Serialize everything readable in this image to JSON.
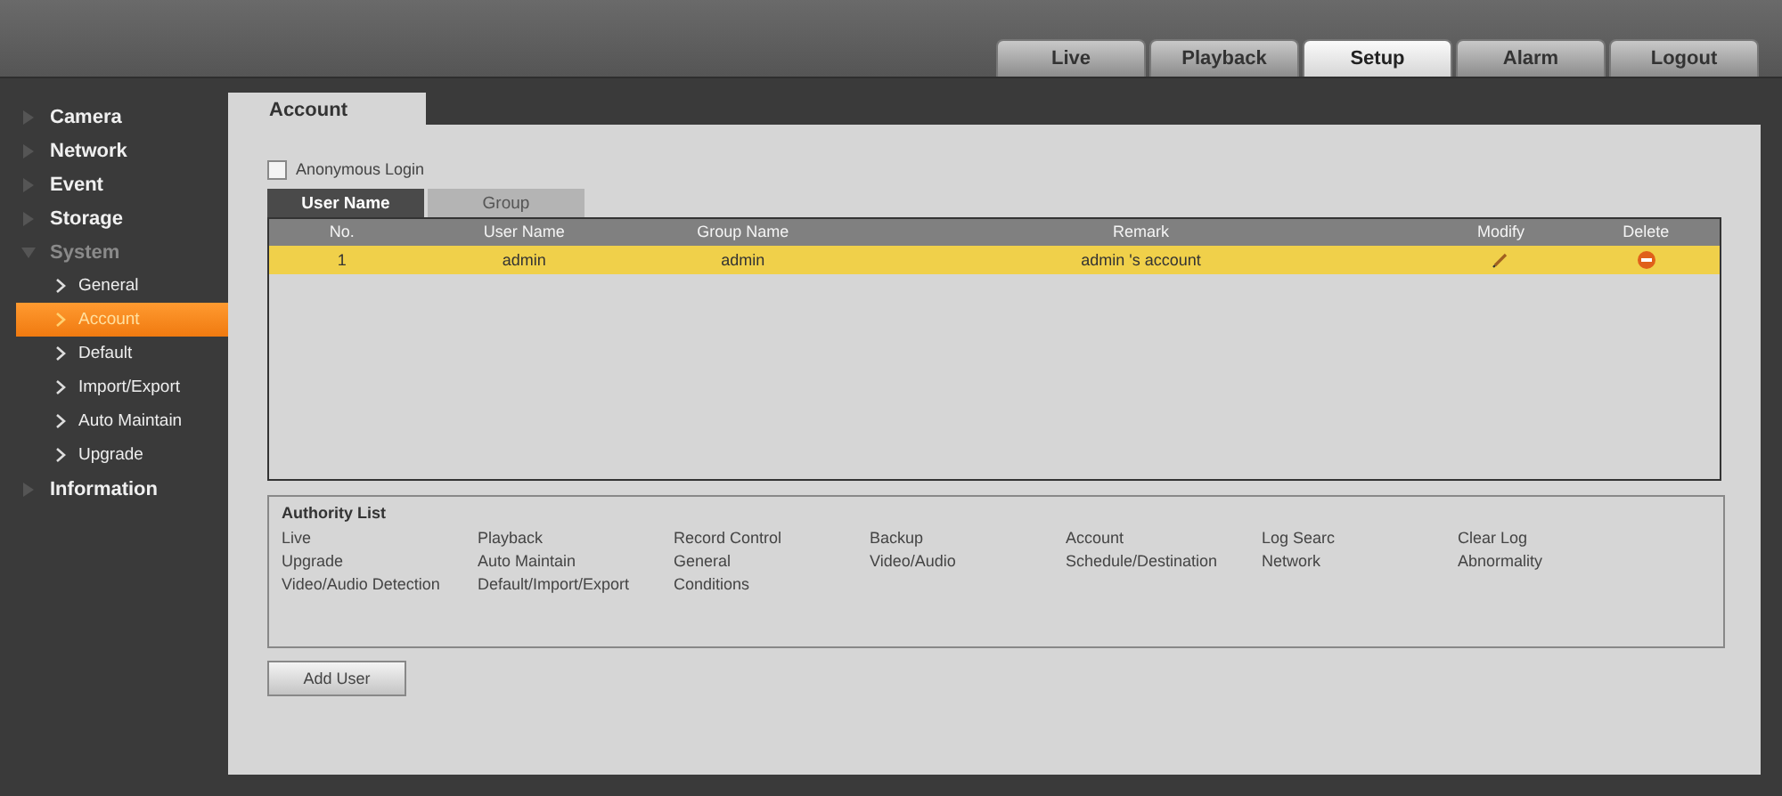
{
  "top_tabs": [
    {
      "label": "Live",
      "selected": false
    },
    {
      "label": "Playback",
      "selected": false
    },
    {
      "label": "Setup",
      "selected": true
    },
    {
      "label": "Alarm",
      "selected": false
    },
    {
      "label": "Logout",
      "selected": false
    }
  ],
  "sidebar": {
    "items": [
      {
        "label": "Camera",
        "expanded": false,
        "selected": false
      },
      {
        "label": "Network",
        "expanded": false,
        "selected": false
      },
      {
        "label": "Event",
        "expanded": false,
        "selected": false
      },
      {
        "label": "Storage",
        "expanded": false,
        "selected": false
      },
      {
        "label": "System",
        "expanded": true,
        "selected": false,
        "children": [
          {
            "label": "General",
            "selected": false
          },
          {
            "label": "Account",
            "selected": true
          },
          {
            "label": "Default",
            "selected": false
          },
          {
            "label": "Import/Export",
            "selected": false
          },
          {
            "label": "Auto Maintain",
            "selected": false
          },
          {
            "label": "Upgrade",
            "selected": false
          }
        ]
      },
      {
        "label": "Information",
        "expanded": false,
        "selected": false
      }
    ]
  },
  "panel_tab": "Account",
  "anonymous_login": {
    "label": "Anonymous Login",
    "checked": false
  },
  "sub_tabs": [
    {
      "label": "User Name",
      "selected": true
    },
    {
      "label": "Group",
      "selected": false
    }
  ],
  "table": {
    "columns": [
      "No.",
      "User Name",
      "Group Name",
      "Remark",
      "Modify",
      "Delete"
    ],
    "rows": [
      {
        "no": "1",
        "user_name": "admin",
        "group_name": "admin",
        "remark": "admin 's account",
        "selected": true
      }
    ]
  },
  "authority_list": {
    "title": "Authority List",
    "items": [
      "Live",
      "Playback",
      "Record Control",
      "Backup",
      "Account",
      "Log Searc",
      "Clear Log",
      "Upgrade",
      "Auto Maintain",
      "General",
      "Video/Audio",
      "Schedule/Destination",
      "Network",
      "Abnormality",
      "Video/Audio Detection",
      "Default/Import/Export",
      "Conditions"
    ]
  },
  "buttons": [
    "Add User"
  ]
}
